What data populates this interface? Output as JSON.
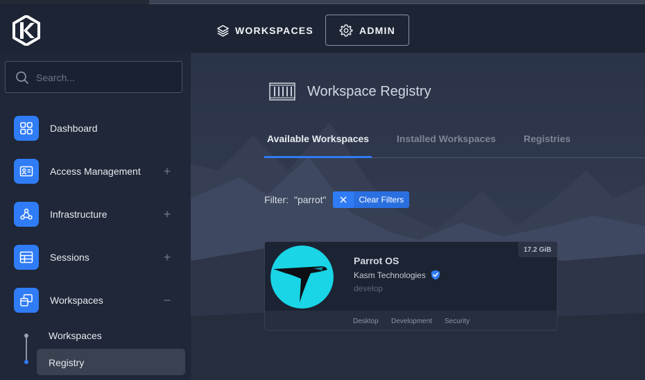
{
  "header": {
    "nav_workspaces": "WORKSPACES",
    "nav_admin": "ADMIN"
  },
  "sidebar": {
    "search_placeholder": "Search...",
    "items": [
      {
        "label": "Dashboard",
        "icon": "dashboard-grid-icon"
      },
      {
        "label": "Access Management",
        "icon": "id-card-icon",
        "toggle": "+"
      },
      {
        "label": "Infrastructure",
        "icon": "webhook-icon",
        "toggle": "+"
      },
      {
        "label": "Sessions",
        "icon": "table-icon",
        "toggle": "+"
      },
      {
        "label": "Workspaces",
        "icon": "windows-stack-icon",
        "toggle": "−"
      }
    ],
    "submenu": [
      {
        "label": "Workspaces"
      },
      {
        "label": "Registry",
        "active": true
      }
    ]
  },
  "main": {
    "page_title": "Workspace Registry",
    "tabs": [
      {
        "label": "Available Workspaces",
        "active": true
      },
      {
        "label": "Installed Workspaces"
      },
      {
        "label": "Registries"
      }
    ],
    "filter": {
      "label": "Filter:",
      "value": "\"parrot\"",
      "clear_label": "Clear Filters"
    },
    "card": {
      "name": "Parrot OS",
      "vendor": "Kasm Technologies",
      "channel": "develop",
      "size": "17.2 GiB",
      "categories": [
        "Desktop",
        "Development",
        "Security"
      ],
      "verified_icon": "verified-shield-icon"
    }
  },
  "colors": {
    "accent": "#2f7cf6",
    "sidebar_bg": "#1f2738",
    "header_bg": "#1d2535",
    "parrot_cyan": "#19d5e6"
  }
}
